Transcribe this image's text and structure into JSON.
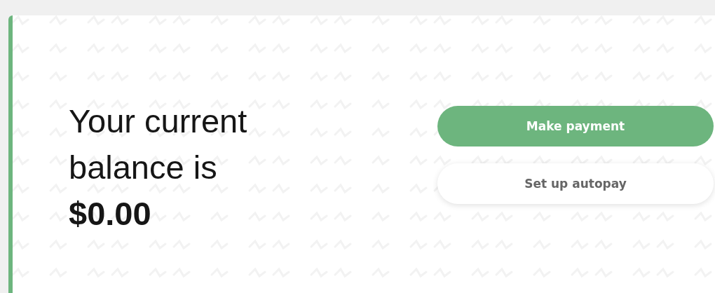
{
  "balance": {
    "text": "Your current balance is **$0.00**"
  },
  "buttons": [
    {
      "label": "Make payment",
      "kind": "primary"
    },
    {
      "label": "Set up autopay",
      "kind": "secondary"
    }
  ]
}
